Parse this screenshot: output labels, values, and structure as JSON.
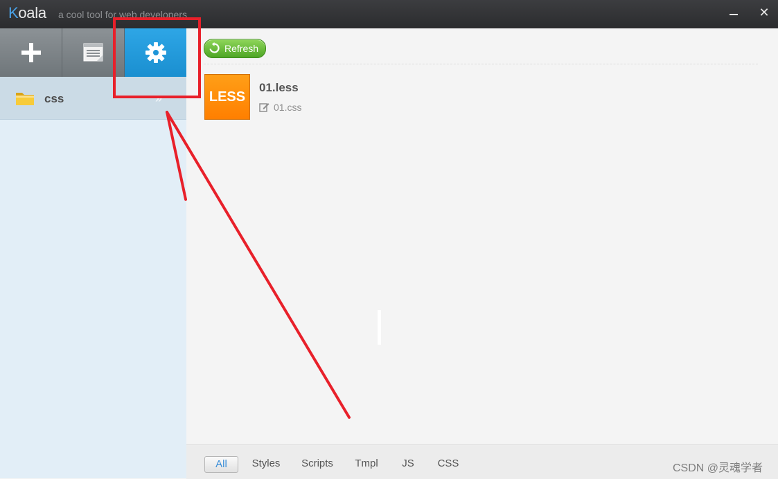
{
  "window": {
    "app_name_first_letter": "K",
    "app_name_rest": "oala",
    "tagline": "a cool tool for web developers",
    "minimize_icon": "minimize-icon",
    "close_icon": "close-icon",
    "close_glyph": "✕"
  },
  "toolbar": {
    "buttons": [
      {
        "icon": "plus-icon"
      },
      {
        "icon": "log-icon"
      },
      {
        "icon": "gear-icon",
        "active": true
      }
    ]
  },
  "sidebar": {
    "projects": [
      {
        "icon": "folder-icon",
        "label": "css",
        "arrow_icon": "double-chevron-right-icon",
        "arrow_glyph": "»"
      }
    ]
  },
  "main": {
    "refresh": {
      "label": "Refresh",
      "icon": "refresh-icon"
    },
    "files": [
      {
        "badge": "LESS",
        "name": "01.less",
        "output_icon": "edit-icon",
        "output": "01.css"
      }
    ],
    "filters": [
      {
        "label": "All",
        "active": true
      },
      {
        "label": "Styles"
      },
      {
        "label": "Scripts"
      },
      {
        "label": "Tmpl"
      },
      {
        "label": "JS"
      },
      {
        "label": "CSS"
      }
    ]
  },
  "watermark": "CSDN @灵魂学者",
  "colors": {
    "accent_blue": "#1a8fd0",
    "less_orange": "#ff8c0a",
    "refresh_green": "#4da525",
    "annotation_red": "#e8202a"
  }
}
